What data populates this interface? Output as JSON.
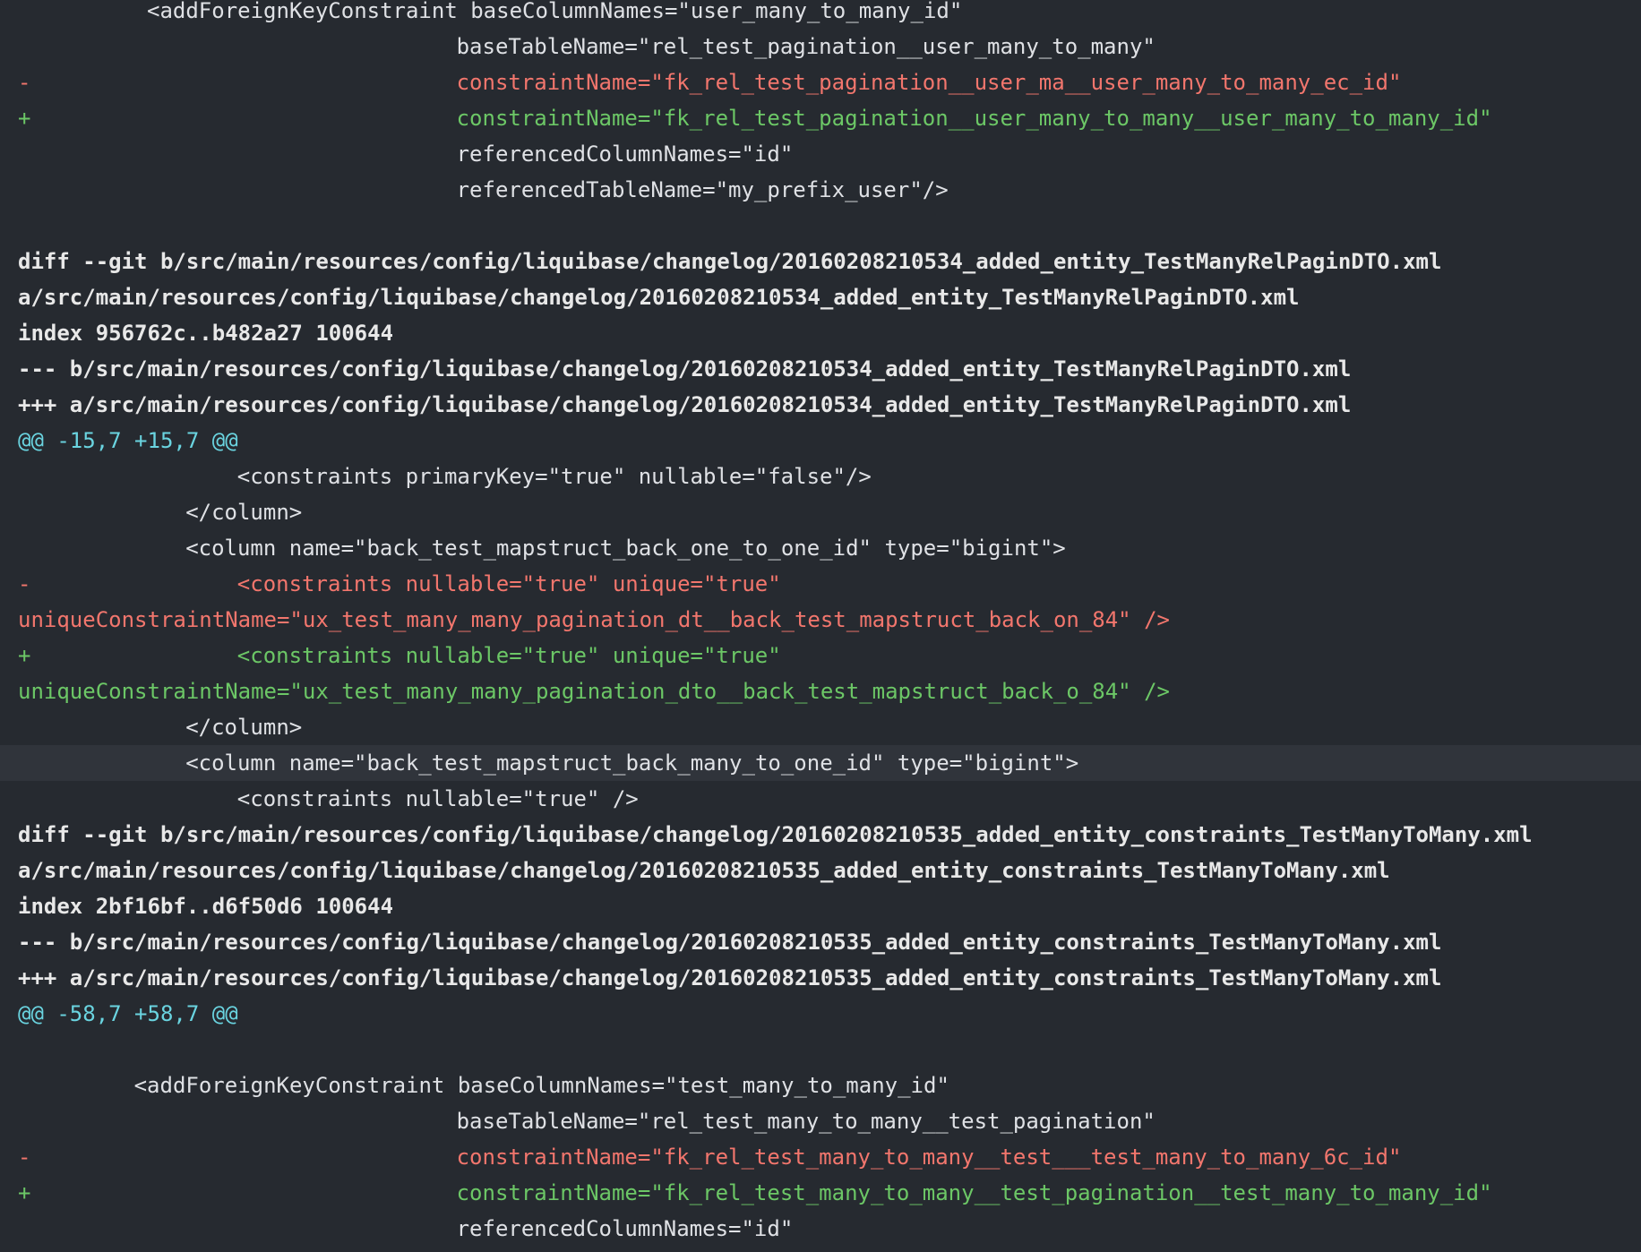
{
  "colors": {
    "background": "#262a30",
    "context": "#dfe1e5",
    "deleted": "#f2766d",
    "added": "#6cc766",
    "hunk_header": "#6ad4e0",
    "highlight_row": "#30343b"
  },
  "lines": [
    {
      "type": "ctx",
      "marker": "",
      "indent": 10,
      "text": "<addForeignKeyConstraint baseColumnNames=\"user_many_to_many_id\""
    },
    {
      "type": "ctx",
      "marker": "",
      "indent": 34,
      "text": "baseTableName=\"rel_test_pagination__user_many_to_many\""
    },
    {
      "type": "del",
      "marker": "-",
      "indent": 34,
      "text": "constraintName=\"fk_rel_test_pagination__user_ma__user_many_to_many_ec_id\""
    },
    {
      "type": "add",
      "marker": "+",
      "indent": 34,
      "text": "constraintName=\"fk_rel_test_pagination__user_many_to_many__user_many_to_many_id\""
    },
    {
      "type": "ctx",
      "marker": "",
      "indent": 34,
      "text": "referencedColumnNames=\"id\""
    },
    {
      "type": "ctx",
      "marker": "",
      "indent": 34,
      "text": "referencedTableName=\"my_prefix_user\"/>"
    },
    {
      "type": "ctx",
      "marker": "",
      "indent": 0,
      "text": ""
    },
    {
      "type": "meta",
      "marker": "",
      "indent": 0,
      "text": "diff --git b/src/main/resources/config/liquibase/changelog/20160208210534_added_entity_TestManyRelPaginDTO.xml"
    },
    {
      "type": "meta",
      "marker": "",
      "indent": 0,
      "text": "a/src/main/resources/config/liquibase/changelog/20160208210534_added_entity_TestManyRelPaginDTO.xml"
    },
    {
      "type": "meta",
      "marker": "",
      "indent": 0,
      "text": "index 956762c..b482a27 100644"
    },
    {
      "type": "meta",
      "marker": "",
      "indent": 0,
      "text": "--- b/src/main/resources/config/liquibase/changelog/20160208210534_added_entity_TestManyRelPaginDTO.xml"
    },
    {
      "type": "meta",
      "marker": "",
      "indent": 0,
      "text": "+++ a/src/main/resources/config/liquibase/changelog/20160208210534_added_entity_TestManyRelPaginDTO.xml"
    },
    {
      "type": "hunk",
      "marker": "",
      "indent": 0,
      "text": "@@ -15,7 +15,7 @@"
    },
    {
      "type": "ctx",
      "marker": "",
      "indent": 17,
      "text": "<constraints primaryKey=\"true\" nullable=\"false\"/>"
    },
    {
      "type": "ctx",
      "marker": "",
      "indent": 13,
      "text": "</column>"
    },
    {
      "type": "ctx",
      "marker": "",
      "indent": 13,
      "text": "<column name=\"back_test_mapstruct_back_one_to_one_id\" type=\"bigint\">"
    },
    {
      "type": "del",
      "marker": "-",
      "indent": 17,
      "text": "<constraints nullable=\"true\" unique=\"true\""
    },
    {
      "type": "del",
      "marker": "",
      "indent": 0,
      "text": "uniqueConstraintName=\"ux_test_many_many_pagination_dt__back_test_mapstruct_back_on_84\" />"
    },
    {
      "type": "add",
      "marker": "+",
      "indent": 17,
      "text": "<constraints nullable=\"true\" unique=\"true\""
    },
    {
      "type": "add",
      "marker": "",
      "indent": 0,
      "text": "uniqueConstraintName=\"ux_test_many_many_pagination_dto__back_test_mapstruct_back_o_84\" />"
    },
    {
      "type": "ctx",
      "marker": "",
      "indent": 13,
      "text": "</column>"
    },
    {
      "type": "ctx",
      "marker": "",
      "indent": 13,
      "text": "<column name=\"back_test_mapstruct_back_many_to_one_id\" type=\"bigint\">",
      "highlight": true
    },
    {
      "type": "ctx",
      "marker": "",
      "indent": 17,
      "text": "<constraints nullable=\"true\" />"
    },
    {
      "type": "meta",
      "marker": "",
      "indent": 0,
      "text": "diff --git b/src/main/resources/config/liquibase/changelog/20160208210535_added_entity_constraints_TestManyToMany.xml"
    },
    {
      "type": "meta",
      "marker": "",
      "indent": 0,
      "text": "a/src/main/resources/config/liquibase/changelog/20160208210535_added_entity_constraints_TestManyToMany.xml"
    },
    {
      "type": "meta",
      "marker": "",
      "indent": 0,
      "text": "index 2bf16bf..d6f50d6 100644"
    },
    {
      "type": "meta",
      "marker": "",
      "indent": 0,
      "text": "--- b/src/main/resources/config/liquibase/changelog/20160208210535_added_entity_constraints_TestManyToMany.xml"
    },
    {
      "type": "meta",
      "marker": "",
      "indent": 0,
      "text": "+++ a/src/main/resources/config/liquibase/changelog/20160208210535_added_entity_constraints_TestManyToMany.xml"
    },
    {
      "type": "hunk",
      "marker": "",
      "indent": 0,
      "text": "@@ -58,7 +58,7 @@"
    },
    {
      "type": "ctx",
      "marker": "",
      "indent": 0,
      "text": ""
    },
    {
      "type": "ctx",
      "marker": "",
      "indent": 9,
      "text": "<addForeignKeyConstraint baseColumnNames=\"test_many_to_many_id\""
    },
    {
      "type": "ctx",
      "marker": "",
      "indent": 34,
      "text": "baseTableName=\"rel_test_many_to_many__test_pagination\""
    },
    {
      "type": "del",
      "marker": "-",
      "indent": 34,
      "text": "constraintName=\"fk_rel_test_many_to_many__test___test_many_to_many_6c_id\""
    },
    {
      "type": "add",
      "marker": "+",
      "indent": 34,
      "text": "constraintName=\"fk_rel_test_many_to_many__test_pagination__test_many_to_many_id\""
    },
    {
      "type": "ctx",
      "marker": "",
      "indent": 34,
      "text": "referencedColumnNames=\"id\""
    }
  ]
}
